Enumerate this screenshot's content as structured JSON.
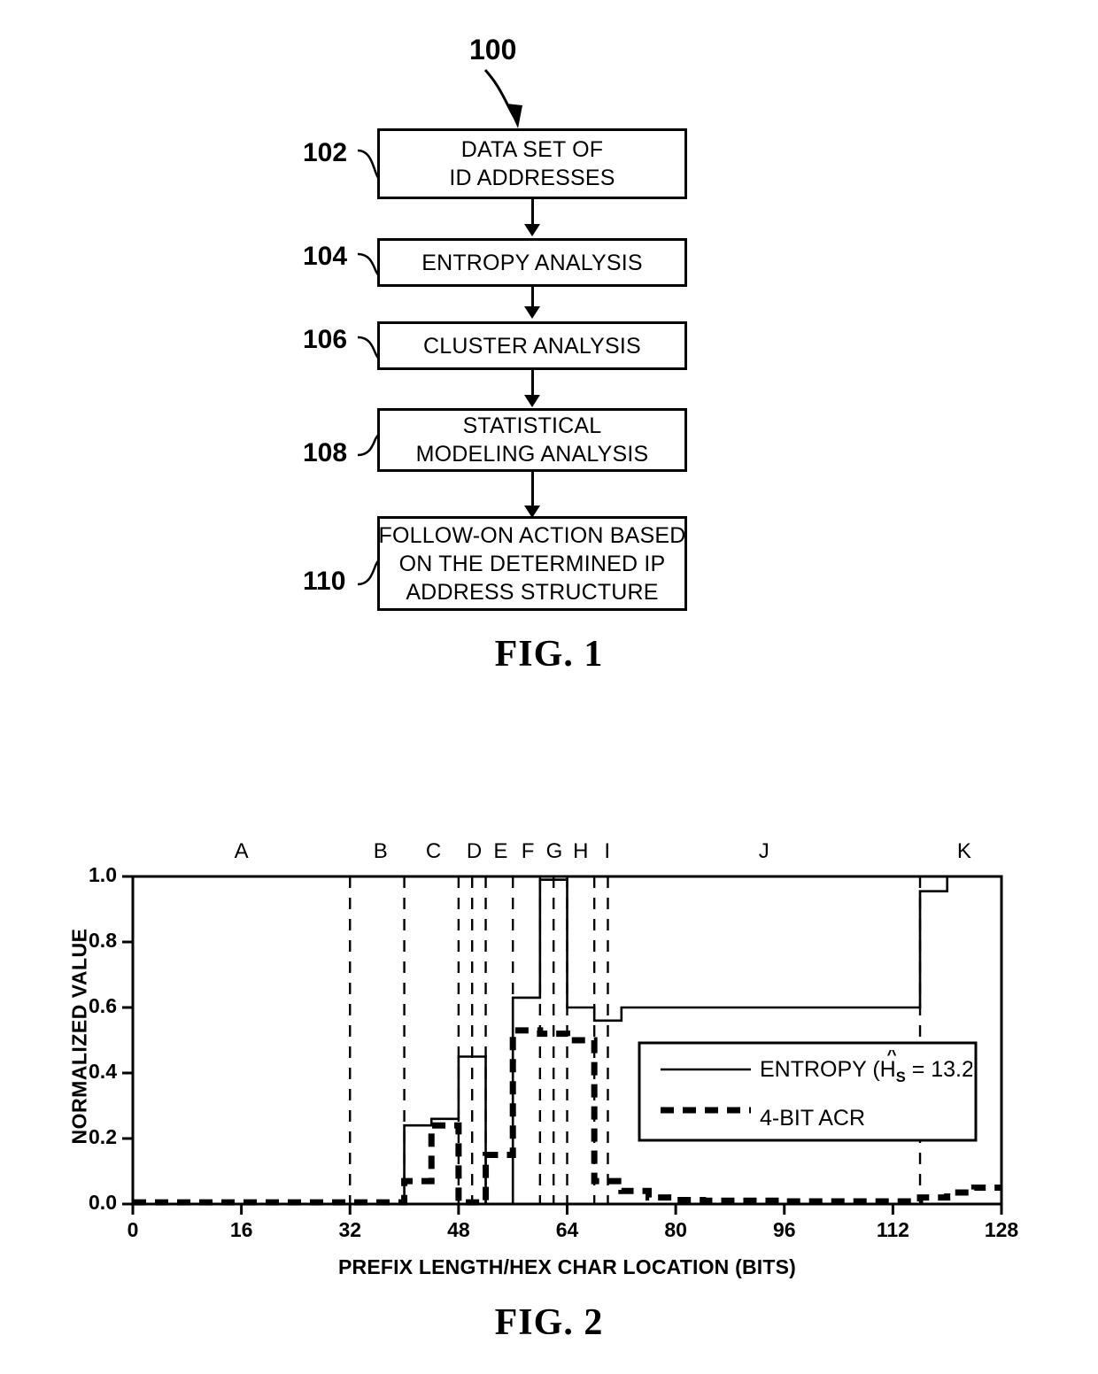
{
  "figure1": {
    "diagram_number": "100",
    "caption": "FIG. 1",
    "steps": [
      {
        "ref": "102",
        "lines": [
          "DATA SET OF",
          "ID ADDRESSES"
        ]
      },
      {
        "ref": "104",
        "lines": [
          "ENTROPY ANALYSIS"
        ]
      },
      {
        "ref": "106",
        "lines": [
          "CLUSTER ANALYSIS"
        ]
      },
      {
        "ref": "108",
        "lines": [
          "STATISTICAL",
          "MODELING ANALYSIS"
        ]
      },
      {
        "ref": "110",
        "lines": [
          "FOLLOW-ON ACTION BASED",
          "ON THE DETERMINED IP",
          "ADDRESS STRUCTURE"
        ]
      }
    ]
  },
  "figure2": {
    "caption": "FIG. 2"
  },
  "chart_data": {
    "type": "line",
    "title": "",
    "xlabel": "PREFIX LENGTH/HEX CHAR LOCATION (BITS)",
    "ylabel": "NORMALIZED VALUE",
    "xlim": [
      0,
      128
    ],
    "ylim": [
      0.0,
      1.0
    ],
    "xticks": [
      0,
      16,
      32,
      48,
      64,
      80,
      96,
      112,
      128
    ],
    "xtick_labels": [
      "0",
      "16",
      "32",
      "48",
      "64",
      "80",
      "96",
      "112",
      "128"
    ],
    "yticks": [
      0.0,
      0.2,
      0.4,
      0.6,
      0.8,
      1.0
    ],
    "ytick_labels": [
      "0.0",
      "0.2",
      "0.4",
      "0.6",
      "0.8",
      "1.0"
    ],
    "grid": false,
    "legend_position": "center-right",
    "legend": [
      {
        "name": "ENTROPY",
        "detail_prefix": "ENTROPY (",
        "symbol": "H",
        "symbol_sub": "S",
        "symbol_hat": "^",
        "detail_suffix": " = 13.2)",
        "style": "solid",
        "color": "#000000"
      },
      {
        "name": "4-BIT ACR",
        "detail_prefix": "4-BIT ACR",
        "symbol": "",
        "symbol_sub": "",
        "symbol_hat": "",
        "detail_suffix": "",
        "style": "dashed",
        "color": "#000000"
      }
    ],
    "region_boundaries": [
      32,
      40,
      48,
      50,
      52,
      56,
      60,
      62,
      64,
      68,
      70,
      116
    ],
    "region_labels": [
      {
        "label": "A",
        "x": 16
      },
      {
        "label": "B",
        "x": 36.5
      },
      {
        "label": "C",
        "x": 44.3
      },
      {
        "label": "D",
        "x": 50.3
      },
      {
        "label": "E",
        "x": 54.2
      },
      {
        "label": "F",
        "x": 58.2
      },
      {
        "label": "G",
        "x": 62.1
      },
      {
        "label": "H",
        "x": 66.0
      },
      {
        "label": "I",
        "x": 69.9
      },
      {
        "label": "J",
        "x": 93.0
      },
      {
        "label": "K",
        "x": 122.5
      }
    ],
    "series": [
      {
        "name": "ENTROPY",
        "style": "solid",
        "step": "post",
        "x": [
          0,
          4,
          8,
          12,
          16,
          20,
          24,
          28,
          32,
          36,
          40,
          44,
          48,
          52,
          56,
          60,
          64,
          68,
          72,
          76,
          80,
          84,
          88,
          92,
          96,
          100,
          104,
          108,
          112,
          116,
          120,
          124,
          128
        ],
        "values": [
          0.0,
          0.0,
          0.0,
          0.0,
          0.0,
          0.0,
          0.0,
          0.0,
          0.0,
          0.0,
          0.24,
          0.26,
          0.45,
          0.0,
          0.63,
          0.99,
          0.6,
          0.56,
          0.6,
          0.6,
          0.6,
          0.6,
          0.6,
          0.6,
          0.6,
          0.6,
          0.6,
          0.6,
          0.6,
          0.955,
          1.0,
          1.0,
          1.0
        ]
      },
      {
        "name": "4-BIT ACR",
        "style": "dashed",
        "step": "post",
        "x": [
          0,
          4,
          8,
          12,
          16,
          20,
          24,
          28,
          32,
          36,
          40,
          44,
          48,
          52,
          56,
          60,
          64,
          68,
          72,
          76,
          80,
          84,
          88,
          92,
          96,
          100,
          104,
          108,
          112,
          116,
          120,
          124,
          128
        ],
        "values": [
          0.005,
          0.005,
          0.005,
          0.005,
          0.005,
          0.005,
          0.005,
          0.005,
          0.005,
          0.005,
          0.07,
          0.24,
          0.005,
          0.15,
          0.53,
          0.52,
          0.5,
          0.07,
          0.04,
          0.02,
          0.012,
          0.01,
          0.01,
          0.01,
          0.008,
          0.008,
          0.008,
          0.008,
          0.008,
          0.02,
          0.035,
          0.05,
          0.05
        ]
      }
    ]
  }
}
